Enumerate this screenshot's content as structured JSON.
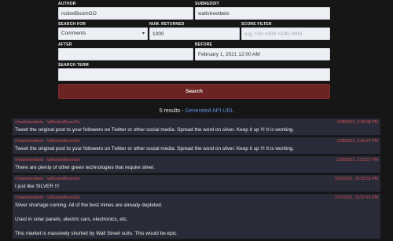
{
  "form": {
    "author": {
      "label": "AUTHOR",
      "value": "rocketBoomGO"
    },
    "subreddit": {
      "label": "SUBREDDIT",
      "value": "wallstreetbets"
    },
    "search_for": {
      "label": "SEARCH FOR",
      "value": "Comments"
    },
    "num_returned": {
      "label": "NUM. RETURNED",
      "value": "1000"
    },
    "score_filter": {
      "label": "SCORE FILTER",
      "placeholder": "e.g. >10 <100 >100,<900"
    },
    "after": {
      "label": "AFTER",
      "value": ""
    },
    "before": {
      "label": "BEFORE",
      "value": "February 1, 2021 12:00 AM"
    },
    "search_term": {
      "label": "SEARCH TERM",
      "value": ""
    },
    "search_button": "Search"
  },
  "results_summary": {
    "count_text": "5 results - ",
    "api_link": "Generated API URL"
  },
  "results": [
    {
      "subreddit": "/r/wallstreetbets",
      "user": "/u/RocketBoomGo",
      "timestamp": "1/28/2021, 3:26:08 PM",
      "lines": [
        " Tweet the original post to your followers on Twitter or other social media. Spread the word on silver. Keep it up !!! It is working."
      ]
    },
    {
      "subreddit": "/r/wallstreetbets",
      "user": "/u/RocketBoomGo",
      "timestamp": "1/28/2021, 3:24:47 PM",
      "lines": [
        "Tweet the original post to your followers on Twitter or other social media. Spread the word on silver. Keep it up !!! It is working."
      ]
    },
    {
      "subreddit": "/r/wallstreetbets",
      "user": "/u/RocketBoomGo",
      "timestamp": "1/28/2021, 3:22:57 PM",
      "lines": [
        "There are plenty of other green technologies that require silver."
      ]
    },
    {
      "subreddit": "/r/wallstreetbets",
      "user": "/u/RocketBoomGo",
      "timestamp": "1/28/2021, 12:33:52 PM",
      "lines": [
        "I just like SILVER !!!"
      ]
    },
    {
      "subreddit": "/r/wallstreetbets",
      "user": "/u/RocketBoomGo",
      "timestamp": "1/27/2021, 12:57:47 PM",
      "lines": [
        "Silver shortage coming. All of the best mines are already depleted.",
        "",
        "Used in solar panels, electric cars, electronics, etc.",
        "",
        "This market is massively shorted by Wall Street suits. This would be epic."
      ]
    }
  ]
}
